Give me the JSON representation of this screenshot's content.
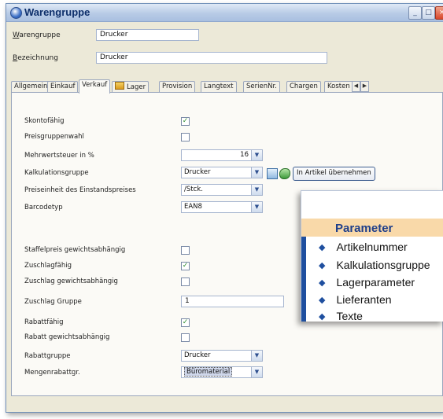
{
  "window": {
    "title": "Warengruppe"
  },
  "header": {
    "warengruppe_label_first": "W",
    "warengruppe_label_rest": "arengruppe",
    "warengruppe_value": "Drucker",
    "bezeichnung_label_first": "B",
    "bezeichnung_label_rest": "ezeichnung",
    "bezeichnung_value": "Drucker"
  },
  "tabs": [
    "Allgemein",
    "Einkauf",
    "Verkauf",
    "Lager",
    "Provision",
    "Langtext",
    "SerienNr.",
    "Chargen",
    "Kosten"
  ],
  "form": {
    "skontofaehig": {
      "label": "Skontofähig",
      "checked": true
    },
    "preisgruppenwahl": {
      "label": "Preisgruppenwahl",
      "checked": false
    },
    "mwst": {
      "label": "Mehrwertsteuer in %",
      "value": "16"
    },
    "kalkulationsgruppe": {
      "label": "Kalkulationsgruppe",
      "value": "Drucker"
    },
    "apply_button": "In Artikel übernehmen",
    "preiseinheit": {
      "label": "Preiseinheit des Einstandspreises",
      "value": "/Stck."
    },
    "barcodetyp": {
      "label": "Barcodetyp",
      "value": "EAN8"
    },
    "staffelpreis": {
      "label": "Staffelpreis gewichtsabhängig",
      "checked": false
    },
    "zuschlagfaehig": {
      "label": "Zuschlagfähig",
      "checked": true
    },
    "zuschlag_gewicht": {
      "label": "Zuschlag gewichtsabhängig",
      "checked": false
    },
    "zuschlag_gruppe": {
      "label": "Zuschlag Gruppe",
      "value": "1"
    },
    "rabattfaehig": {
      "label": "Rabattfähig",
      "checked": true
    },
    "rabatt_gewicht": {
      "label": "Rabatt gewichtsabhängig",
      "checked": false
    },
    "rabattgruppe": {
      "label": "Rabattgruppe",
      "value": "Drucker"
    },
    "mengenrabatt": {
      "label": "Mengenrabattgr.",
      "value": "Büromaterial"
    }
  },
  "overlay": {
    "title": "Parameter",
    "items": [
      "Artikelnummer",
      "Kalkulationsgruppe",
      "Lagerparameter",
      "Lieferanten",
      "Texte"
    ]
  },
  "colors": {
    "overlay_bar": "#f9d9a9",
    "overlay_title": "#1f3f8a",
    "bullet": "#1f4f9f",
    "check": "#2a8a2a"
  }
}
